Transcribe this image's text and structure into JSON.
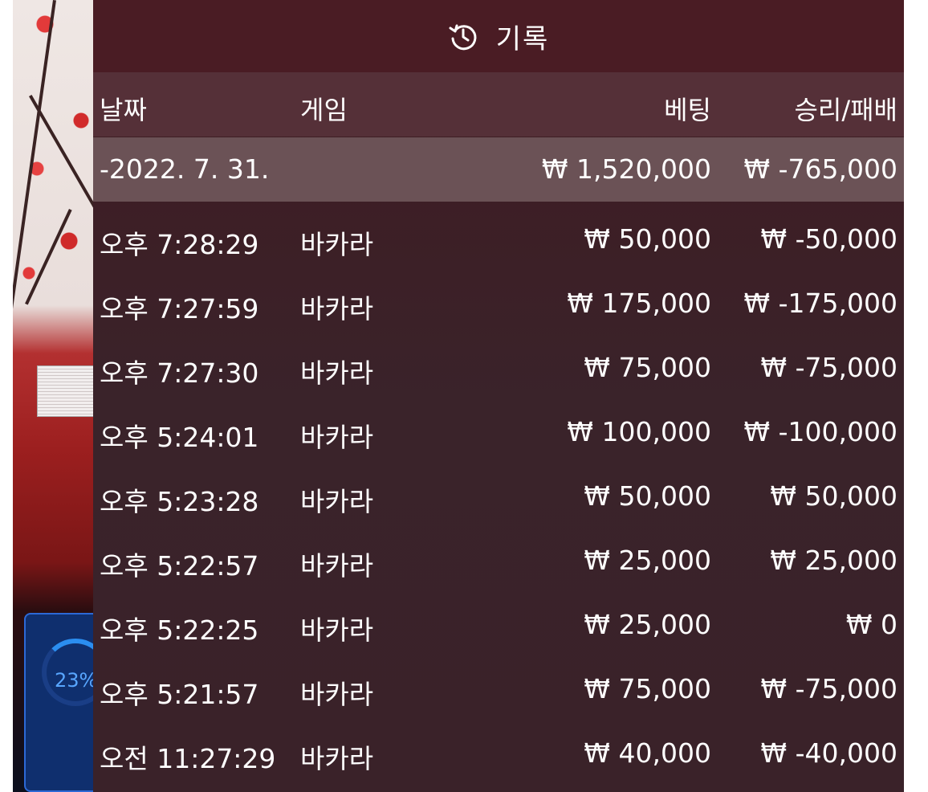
{
  "header": {
    "icon": "history-icon",
    "title": "기록"
  },
  "columns": {
    "date": "날짜",
    "game": "게임",
    "bet": "베팅",
    "result": "승리/패배"
  },
  "summary": {
    "date": "-2022. 7. 31.",
    "bet": "₩ 1,520,000",
    "result": "₩ -765,000"
  },
  "rows": [
    {
      "time": "오후 7:28:29",
      "game": "바카라",
      "bet": "₩ 50,000",
      "result": "₩ -50,000"
    },
    {
      "time": "오후 7:27:59",
      "game": "바카라",
      "bet": "₩ 175,000",
      "result": "₩ -175,000"
    },
    {
      "time": "오후 7:27:30",
      "game": "바카라",
      "bet": "₩ 75,000",
      "result": "₩ -75,000"
    },
    {
      "time": "오후 5:24:01",
      "game": "바카라",
      "bet": "₩ 100,000",
      "result": "₩ -100,000"
    },
    {
      "time": "오후 5:23:28",
      "game": "바카라",
      "bet": "₩ 50,000",
      "result": "₩ 50,000"
    },
    {
      "time": "오후 5:22:57",
      "game": "바카라",
      "bet": "₩ 25,000",
      "result": "₩ 25,000"
    },
    {
      "time": "오후 5:22:25",
      "game": "바카라",
      "bet": "₩ 25,000",
      "result": "₩ 0"
    },
    {
      "time": "오후 5:21:57",
      "game": "바카라",
      "bet": "₩ 75,000",
      "result": "₩ -75,000"
    },
    {
      "time": "오전 11:27:29",
      "game": "바카라",
      "bet": "₩ 40,000",
      "result": "₩ -40,000"
    }
  ],
  "side_widget": {
    "percent": "23%"
  }
}
